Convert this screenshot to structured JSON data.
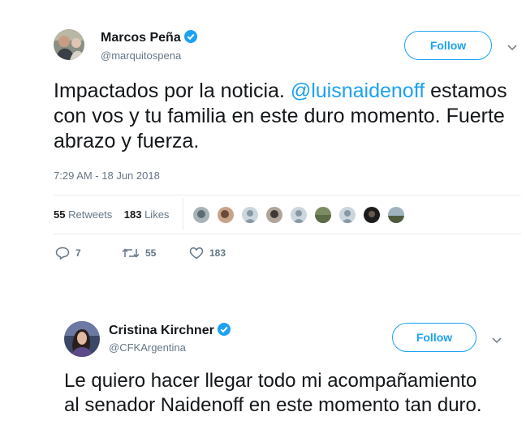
{
  "tweets": [
    {
      "author": {
        "name": "Marcos Peña",
        "handle": "@marquitospena"
      },
      "follow_label": "Follow",
      "text_before": "Impactados por la noticia. ",
      "mention": "@luisnaidenoff",
      "text_after": "estamos con vos y tu familia en este duro momento. Fuerte abrazo y fuerza.",
      "timestamp": "7:29 AM - 18 Jun 2018",
      "retweets": {
        "count": "55",
        "label": "Retweets"
      },
      "likes": {
        "count": "183",
        "label": "Likes"
      },
      "actions": {
        "reply": "7",
        "retweet": "55",
        "like": "183"
      }
    },
    {
      "author": {
        "name": "Cristina Kirchner",
        "handle": "@CFKArgentina"
      },
      "follow_label": "Follow",
      "text": "Le quiero hacer llegar todo mi acompañamiento al senador Naidenoff en este momento tan duro."
    }
  ],
  "icons": {
    "verified": "verified-badge-icon",
    "chevron": "chevron-down-icon",
    "reply": "reply-icon",
    "retweet": "retweet-icon",
    "like": "heart-icon"
  },
  "colors": {
    "accent": "#1da1f2",
    "muted": "#657786",
    "text": "#14171a",
    "divider": "#e6ecf0"
  }
}
